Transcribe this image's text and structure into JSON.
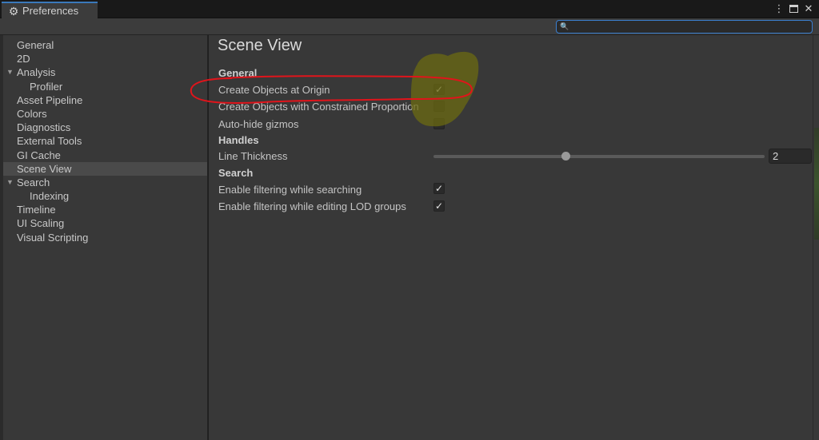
{
  "window": {
    "tab_title": "Preferences",
    "tab_icon": "gear-icon",
    "controls": [
      "more-options-icon",
      "maximize-icon",
      "close-icon"
    ]
  },
  "search": {
    "value": "",
    "placeholder": ""
  },
  "sidebar": {
    "items": [
      {
        "label": "General",
        "level": 0,
        "expandable": false,
        "selected": false
      },
      {
        "label": "2D",
        "level": 0,
        "expandable": false,
        "selected": false
      },
      {
        "label": "Analysis",
        "level": 0,
        "expandable": true,
        "selected": false
      },
      {
        "label": "Profiler",
        "level": 1,
        "expandable": false,
        "selected": false
      },
      {
        "label": "Asset Pipeline",
        "level": 0,
        "expandable": false,
        "selected": false
      },
      {
        "label": "Colors",
        "level": 0,
        "expandable": false,
        "selected": false
      },
      {
        "label": "Diagnostics",
        "level": 0,
        "expandable": false,
        "selected": false
      },
      {
        "label": "External Tools",
        "level": 0,
        "expandable": false,
        "selected": false
      },
      {
        "label": "GI Cache",
        "level": 0,
        "expandable": false,
        "selected": false
      },
      {
        "label": "Scene View",
        "level": 0,
        "expandable": false,
        "selected": true
      },
      {
        "label": "Search",
        "level": 0,
        "expandable": true,
        "selected": false
      },
      {
        "label": "Indexing",
        "level": 1,
        "expandable": false,
        "selected": false
      },
      {
        "label": "Timeline",
        "level": 0,
        "expandable": false,
        "selected": false
      },
      {
        "label": "UI Scaling",
        "level": 0,
        "expandable": false,
        "selected": false
      },
      {
        "label": "Visual Scripting",
        "level": 0,
        "expandable": false,
        "selected": false
      }
    ]
  },
  "content": {
    "title": "Scene View",
    "general": {
      "heading": "General",
      "create_at_origin": {
        "label": "Create Objects at Origin",
        "checked": true
      },
      "constrained": {
        "label": "Create Objects with Constrained Proportion",
        "checked": false
      },
      "autohide": {
        "label": "Auto-hide gizmos",
        "checked": false
      }
    },
    "handles": {
      "heading": "Handles",
      "line_thickness": {
        "label": "Line Thickness",
        "value": "2",
        "slider_fraction": 0.4
      }
    },
    "search": {
      "heading": "Search",
      "filter_searching": {
        "label": "Enable filtering while searching",
        "checked": true
      },
      "filter_lod": {
        "label": "Enable filtering while editing LOD groups",
        "checked": true
      }
    }
  },
  "colors": {
    "accent": "#3a79bb",
    "annotation_red": "#e0141b",
    "annotation_highlight": "#6b6a12"
  }
}
